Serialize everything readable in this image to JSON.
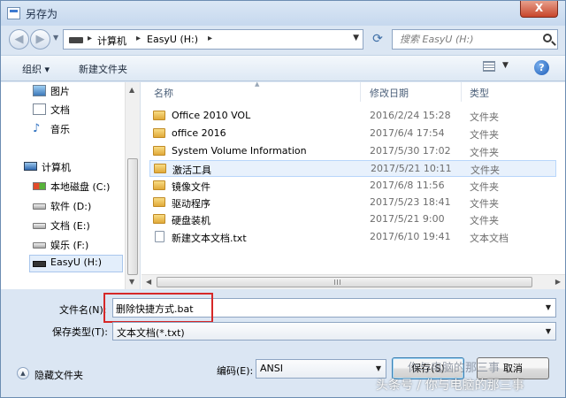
{
  "window": {
    "title": "另存为",
    "close_glyph": "X"
  },
  "nav": {
    "back_glyph": "◀",
    "forward_glyph": "▶",
    "breadcrumbs": [
      "计算机",
      "EasyU (H:)"
    ],
    "search_placeholder": "搜索 EasyU (H:)"
  },
  "toolbar": {
    "organize_label": "组织 ▾",
    "new_folder_label": "新建文件夹",
    "help_glyph": "?"
  },
  "sidebar": {
    "items": [
      {
        "label": "图片",
        "icon": "pictures-icon"
      },
      {
        "label": "文档",
        "icon": "documents-icon"
      },
      {
        "label": "音乐",
        "icon": "music-icon"
      },
      {
        "label": "计算机",
        "icon": "computer-icon"
      },
      {
        "label": "本地磁盘 (C:)",
        "icon": "system-drive-icon"
      },
      {
        "label": "软件 (D:)",
        "icon": "drive-icon"
      },
      {
        "label": "文档 (E:)",
        "icon": "drive-icon"
      },
      {
        "label": "娱乐 (F:)",
        "icon": "drive-icon"
      },
      {
        "label": "EasyU (H:)",
        "icon": "usb-drive-icon",
        "selected": true
      }
    ]
  },
  "filelist": {
    "columns": {
      "name": "名称",
      "date": "修改日期",
      "type": "类型"
    },
    "rows": [
      {
        "name": "Office 2010 VOL",
        "date": "2016/2/24 15:28",
        "type": "文件夹",
        "icon": "folder-icon"
      },
      {
        "name": "office 2016",
        "date": "2017/6/4 17:54",
        "type": "文件夹",
        "icon": "folder-icon"
      },
      {
        "name": "System Volume Information",
        "date": "2017/5/30 17:02",
        "type": "文件夹",
        "icon": "folder-icon"
      },
      {
        "name": "激活工具",
        "date": "2017/5/21 10:11",
        "type": "文件夹",
        "icon": "folder-icon",
        "hover": true
      },
      {
        "name": "镜像文件",
        "date": "2017/6/8 11:56",
        "type": "文件夹",
        "icon": "folder-icon"
      },
      {
        "name": "驱动程序",
        "date": "2017/5/23 18:41",
        "type": "文件夹",
        "icon": "folder-icon"
      },
      {
        "name": "硬盘装机",
        "date": "2017/5/21 9:00",
        "type": "文件夹",
        "icon": "folder-icon"
      },
      {
        "name": "新建文本文档.txt",
        "date": "2017/6/10 19:41",
        "type": "文本文档",
        "icon": "text-file-icon"
      }
    ]
  },
  "form": {
    "filename_label": "文件名(N):",
    "filename_value": "删除快捷方式.bat",
    "filetype_label": "保存类型(T):",
    "filetype_value": "文本文档(*.txt)",
    "encoding_label": "编码(E):",
    "encoding_value": "ANSI",
    "hide_folders_label": "隐藏文件夹",
    "save_label": "保存(S)",
    "cancel_label": "取消"
  },
  "watermark": {
    "line1": "你与电脑的那三事",
    "line2": "头条号 / 你与电脑的那三事"
  },
  "colors": {
    "highlight": "#d62828",
    "window_frame": "#dbe6f3",
    "accent": "#3c7fb1"
  }
}
